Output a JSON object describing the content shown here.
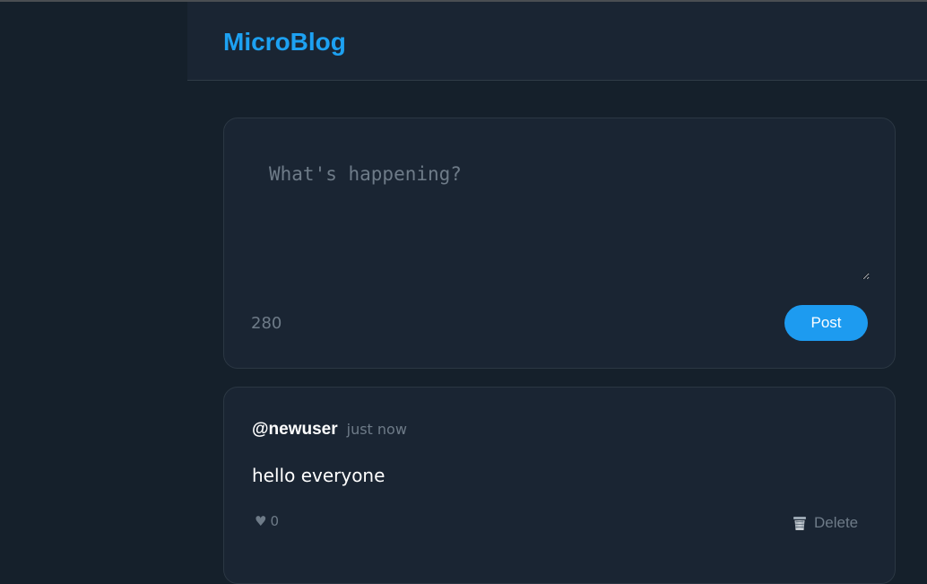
{
  "app": {
    "title": "MicroBlog"
  },
  "compose": {
    "placeholder": "What's happening?",
    "char_count": "280",
    "post_label": "Post"
  },
  "posts": [
    {
      "username": "@newuser",
      "timestamp": "just now",
      "text": "hello everyone",
      "like_icon": "♥",
      "likes": "0",
      "delete_label": "Delete"
    }
  ],
  "colors": {
    "accent": "#1da1f2",
    "background": "#15202b",
    "card": "#1a2533",
    "muted": "#6e7b88"
  }
}
